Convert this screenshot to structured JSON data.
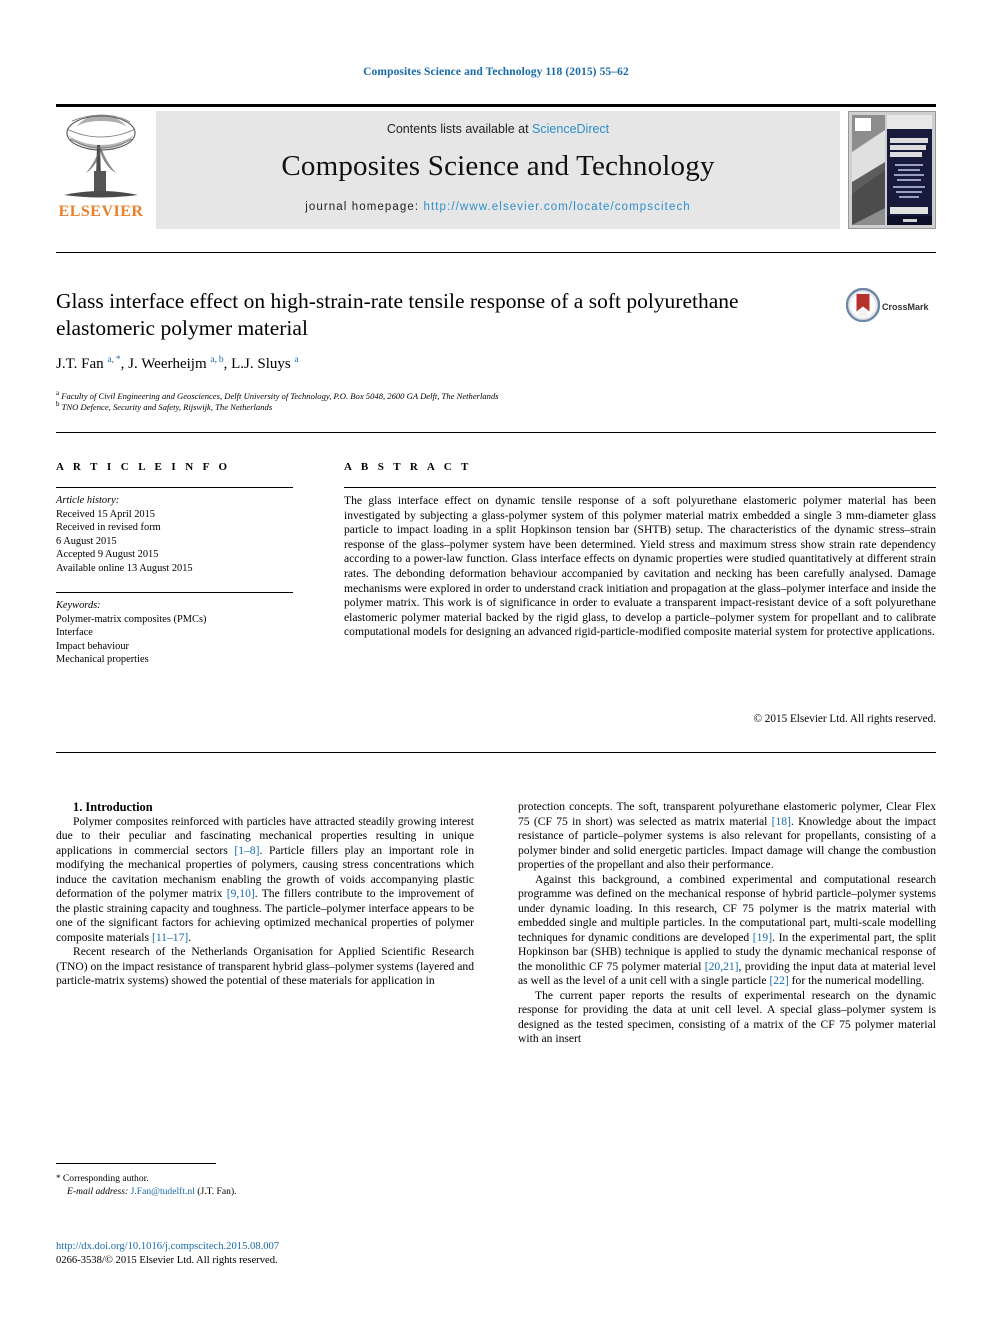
{
  "running_head": "Composites Science and Technology 118 (2015) 55–62",
  "masthead": {
    "contents_prefix": "Contents lists available at ",
    "sciencedirect": "ScienceDirect",
    "journal_title": "Composites Science and Technology",
    "homepage_label": "journal homepage:",
    "homepage_url": "http://www.elsevier.com/locate/compscitech",
    "publisher": "ELSEVIER",
    "cover_title_line1": "COMPOSITES",
    "cover_title_line2": "SCIENCE AND",
    "cover_title_line3": "TECHNOLOGY"
  },
  "colors": {
    "link": "#1a6aa8",
    "sciencedirect": "#2d8fc9",
    "elsevier_orange": "#E8812A",
    "masthead_gray": "#e6e6e6",
    "crossmark_red": "#b5322c"
  },
  "article": {
    "title": "Glass interface effect on high-strain-rate tensile response of a soft polyurethane elastomeric polymer material",
    "crossmark_label": "CrossMark",
    "authors_html": "J.T. Fan <sup>a, *</sup>, J. Weerheijm <sup>a, b</sup>, L.J. Sluys <sup>a</sup>",
    "affiliation_a": "Faculty of Civil Engineering and Geosciences, Delft University of Technology, P.O. Box 5048, 2600 GA Delft, The Netherlands",
    "affiliation_b": "TNO Defence, Security and Safety, Rijswijk, The Netherlands"
  },
  "article_info": {
    "heading": "A R T I C L E   I N F O",
    "history_label": "Article history:",
    "history": [
      "Received 15 April 2015",
      "Received in revised form",
      "6 August 2015",
      "Accepted 9 August 2015",
      "Available online 13 August 2015"
    ],
    "keywords_label": "Keywords:",
    "keywords": [
      "Polymer-matrix composites (PMCs)",
      "Interface",
      "Impact behaviour",
      "Mechanical properties"
    ]
  },
  "abstract": {
    "heading": "A B S T R A C T",
    "text": "The glass interface effect on dynamic tensile response of a soft polyurethane elastomeric polymer material has been investigated by subjecting a glass-polymer system of this polymer material matrix embedded a single 3 mm-diameter glass particle to impact loading in a split Hopkinson tension bar (SHTB) setup. The characteristics of the dynamic stress–strain response of the glass–polymer system have been determined. Yield stress and maximum stress show strain rate dependency according to a power-law function. Glass interface effects on dynamic properties were studied quantitatively at different strain rates. The debonding deformation behaviour accompanied by cavitation and necking has been carefully analysed. Damage mechanisms were explored in order to understand crack initiation and propagation at the glass–polymer interface and inside the polymer matrix. This work is of significance in order to evaluate a transparent impact-resistant device of a soft polyurethane elastomeric polymer material backed by the rigid glass, to develop a particle–polymer system for propellant and to calibrate computational models for designing an advanced rigid-particle-modified composite material system for protective applications.",
    "copyright": "© 2015 Elsevier Ltd. All rights reserved."
  },
  "body": {
    "section_title": "1. Introduction",
    "left_paragraphs": [
      "Polymer composites reinforced with particles have attracted steadily growing interest due to their peculiar and fascinating mechanical properties resulting in unique applications in commercial sectors [1–8]. Particle fillers play an important role in modifying the mechanical properties of polymers, causing stress concentrations which induce the cavitation mechanism enabling the growth of voids accompanying plastic deformation of the polymer matrix [9,10]. The fillers contribute to the improvement of the plastic straining capacity and toughness. The particle–polymer interface appears to be one of the significant factors for achieving optimized mechanical properties of polymer composite materials [11–17].",
      "Recent research of the Netherlands Organisation for Applied Scientific Research (TNO) on the impact resistance of transparent hybrid glass–polymer systems (layered and particle-matrix systems) showed the potential of these materials for application in"
    ],
    "right_paragraphs": [
      "protection concepts. The soft, transparent polyurethane elastomeric polymer, Clear Flex 75 (CF 75 in short) was selected as matrix material [18]. Knowledge about the impact resistance of particle–polymer systems is also relevant for propellants, consisting of a polymer binder and solid energetic particles. Impact damage will change the combustion properties of the propellant and also their performance.",
      "Against this background, a combined experimental and computational research programme was defined on the mechanical response of hybrid particle–polymer systems under dynamic loading. In this research, CF 75 polymer is the matrix material with embedded single and multiple particles. In the computational part, multi-scale modelling techniques for dynamic conditions are developed [19]. In the experimental part, the split Hopkinson bar (SHB) technique is applied to study the dynamic mechanical response of the monolithic CF 75 polymer material [20,21], providing the input data at material level as well as the level of a unit cell with a single particle [22] for the numerical modelling.",
      "The current paper reports the results of experimental research on the dynamic response for providing the data at unit cell level. A special glass–polymer system is designed as the tested specimen, consisting of a matrix of the CF 75 polymer material with an insert"
    ]
  },
  "footer": {
    "corresponding_marker": "*",
    "corresponding_text": "Corresponding author.",
    "email_label": "E-mail address:",
    "email": "J.Fan@tudelft.nl",
    "email_owner": "(J.T. Fan).",
    "doi_url": "http://dx.doi.org/10.1016/j.compscitech.2015.08.007",
    "issn_line": "0266-3538/© 2015 Elsevier Ltd. All rights reserved."
  }
}
